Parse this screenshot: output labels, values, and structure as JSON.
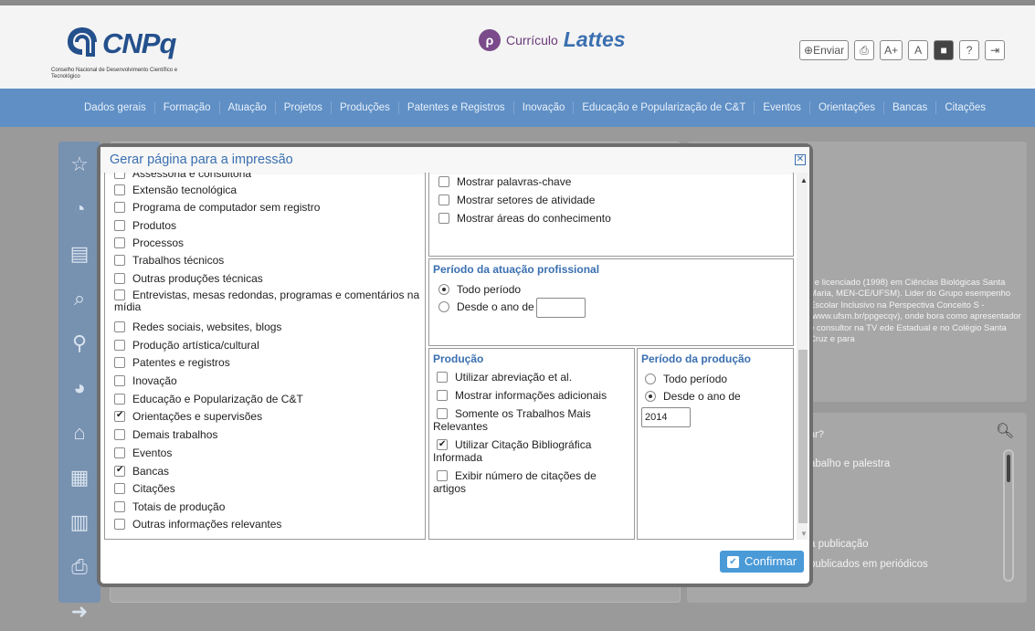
{
  "header": {
    "logo_text": "CNPq",
    "logo_sub": "Conselho Nacional de Desenvolvimento Científico e Tecnológico",
    "app_label": "Currículo",
    "app_title": "Lattes",
    "tools": {
      "send": "Enviar",
      "print_icon": "printer-icon",
      "font_increase": "A+",
      "font_normal": "A",
      "contrast": "■",
      "help": "?",
      "exit": "exit-icon"
    }
  },
  "nav": {
    "items": [
      "Dados gerais",
      "Formação",
      "Atuação",
      "Projetos",
      "Produções",
      "Patentes e Registros",
      "Inovação",
      "Educação e Popularização de C&T",
      "Eventos",
      "Orientações",
      "Bancas",
      "Citações"
    ]
  },
  "background": {
    "bio_text": ") e licenciado (1998) em Ciências Biológicas Santa Maria, MEN-CE/UFSM). Lider do Grupo esempenho Escolar Inclusivo na Perspectiva Conceito S - (www.ufsm.br/ppgecqv), onde bora como apresentador e consultor na TV ede Estadual e no Colégio Santa Cruz e para",
    "search_fragment": "ar?",
    "list_fragments": [
      "abalho e palestra",
      "a publicação",
      "publicados em periódicos"
    ]
  },
  "modal": {
    "title": "Gerar página para a impressão",
    "col1_items": [
      {
        "label": "Assessoria e consultoria",
        "checked": false
      },
      {
        "label": "Extensão tecnológica",
        "checked": false
      },
      {
        "label": "Programa de computador sem registro",
        "checked": false
      },
      {
        "label": "Produtos",
        "checked": false
      },
      {
        "label": "Processos",
        "checked": false
      },
      {
        "label": "Trabalhos técnicos",
        "checked": false
      },
      {
        "label": "Outras produções técnicas",
        "checked": false
      },
      {
        "label": "Entrevistas, mesas redondas, programas e comentários na mídia",
        "checked": false
      },
      {
        "label": "Redes sociais, websites, blogs",
        "checked": false
      },
      {
        "label": "Produção artística/cultural",
        "checked": false
      },
      {
        "label": "Patentes e registros",
        "checked": false
      },
      {
        "label": "Inovação",
        "checked": false
      },
      {
        "label": "Educação e Popularização de C&T",
        "checked": false
      },
      {
        "label": "Orientações e supervisões",
        "checked": true
      },
      {
        "label": "Demais trabalhos",
        "checked": false
      },
      {
        "label": "Eventos",
        "checked": false
      },
      {
        "label": "Bancas",
        "checked": true
      },
      {
        "label": "Citações",
        "checked": false
      },
      {
        "label": "Totais de produção",
        "checked": false
      },
      {
        "label": "Outras informações relevantes",
        "checked": false
      }
    ],
    "col2_top_items": [
      {
        "label": "Mostrar palavras-chave",
        "checked": false
      },
      {
        "label": "Mostrar setores de atividade",
        "checked": false
      },
      {
        "label": "Mostrar áreas do conhecimento",
        "checked": false
      }
    ],
    "periodo_atuacao": {
      "title": "Período da atuação profissional",
      "all_period": "Todo período",
      "since_year": "Desde o ano de",
      "year_value": ""
    },
    "producao": {
      "title": "Produção",
      "items": [
        {
          "label": "Utilizar abreviação et al.",
          "checked": false
        },
        {
          "label": "Mostrar informações adicionais",
          "checked": false
        },
        {
          "label": "Somente os Trabalhos Mais Relevantes",
          "checked": false
        },
        {
          "label": "Utilizar Citação Bibliográfica Informada",
          "checked": true
        },
        {
          "label": "Exibir número de citações de artigos",
          "checked": false
        }
      ]
    },
    "periodo_producao": {
      "title": "Período da produção",
      "all_period": "Todo período",
      "since_year": "Desde o ano de",
      "year_value": "2014"
    },
    "confirm_label": "Confirmar"
  }
}
